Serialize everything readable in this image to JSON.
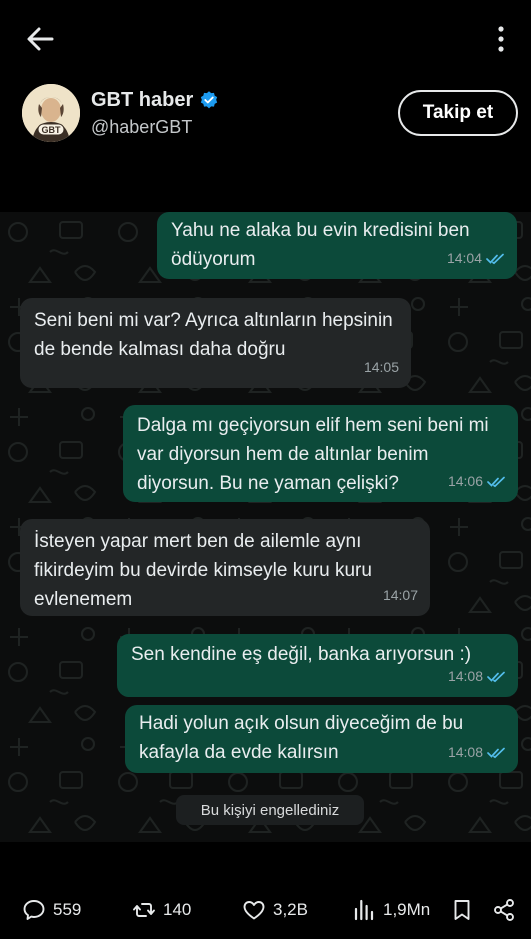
{
  "post": {
    "author": {
      "display_name": "GBT haber",
      "handle": "@haberGBT",
      "avatar_label": "GBT",
      "verified": true,
      "follow_label": "Takip et"
    }
  },
  "chat": {
    "messages": [
      {
        "direction": "out",
        "text": "Yahu ne alaka bu evin kredisini ben ödüyorum",
        "time": "14:04",
        "read": true
      },
      {
        "direction": "in",
        "text": "Seni beni mi var? Ayrıca altınların hepsinin de bende kalması daha doğru",
        "time": "14:05"
      },
      {
        "direction": "out",
        "text": "Dalga mı geçiyorsun elif hem seni beni mi var diyorsun hem de altınlar benim diyorsun. Bu ne yaman çelişki?",
        "time": "14:06",
        "read": true
      },
      {
        "direction": "in",
        "text": "İsteyen yapar mert ben de ailemle aynı fikirdeyim bu devirde kimseyle kuru kuru evlenemem",
        "time": "14:07"
      },
      {
        "direction": "out",
        "text": "Sen kendine eş değil, banka arıyorsun :)",
        "time": "14:08",
        "read": true
      },
      {
        "direction": "out",
        "text": "Hadi yolun açık olsun diyeceğim de bu kafayla da evde kalırsın",
        "time": "14:08",
        "read": true
      }
    ],
    "system_message": "Bu kişiyi engellediniz"
  },
  "actions": {
    "replies": "559",
    "reposts": "140",
    "likes": "3,2B",
    "views": "1,9Mn"
  },
  "colors": {
    "background": "#000000",
    "outgoing_bubble": "#0c4a3a",
    "incoming_bubble": "#232627",
    "verified_badge": "#1d9bf0",
    "read_ticks": "#53bdeb"
  },
  "icons": [
    "back-arrow-icon",
    "more-vertical-icon",
    "verified-badge-icon",
    "double-check-icon",
    "reply-icon",
    "repost-icon",
    "like-icon",
    "views-icon",
    "bookmark-icon",
    "share-icon"
  ]
}
